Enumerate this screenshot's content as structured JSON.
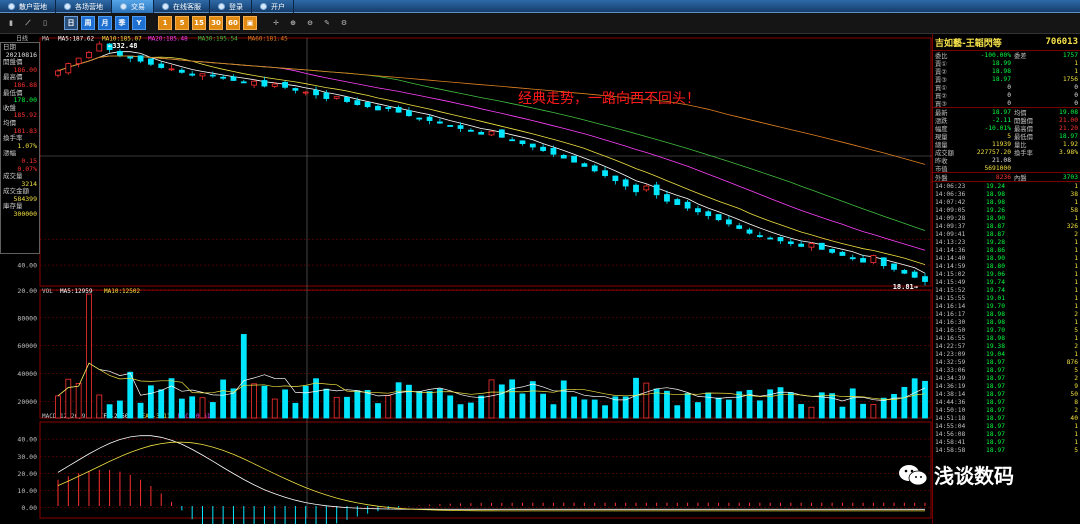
{
  "tabs": [
    "散户营地",
    "各场营地",
    "交易",
    "在线客服",
    "登录",
    "开户"
  ],
  "active_tab": 2,
  "toolbar": {
    "buttons": [
      {
        "icon": "bar-chart-icon",
        "style": "plain",
        "label": "▮"
      },
      {
        "icon": "line-chart-icon",
        "style": "plain",
        "label": "⟋"
      },
      {
        "icon": "candle-icon",
        "style": "plain",
        "label": "▯"
      },
      {
        "icon": "daily-kline-icon",
        "style": "sel",
        "label": "日"
      },
      {
        "icon": "weekly-icon",
        "style": "blue",
        "label": "周"
      },
      {
        "icon": "monthly-icon",
        "style": "blue",
        "label": "月"
      },
      {
        "icon": "quarter-icon",
        "style": "blue",
        "label": "季"
      },
      {
        "icon": "year-icon",
        "style": "blue",
        "label": "Y"
      },
      {
        "icon": "minute-1-icon",
        "style": "orange",
        "label": "1"
      },
      {
        "icon": "minute-5-icon",
        "style": "orange",
        "label": "5"
      },
      {
        "icon": "minute-15-icon",
        "style": "orange",
        "label": "15"
      },
      {
        "icon": "minute-30-icon",
        "style": "orange",
        "label": "30"
      },
      {
        "icon": "minute-60-icon",
        "style": "orange",
        "label": "60"
      },
      {
        "icon": "lock-period-icon",
        "style": "orange",
        "label": "▣"
      },
      {
        "icon": "crosshair-icon",
        "style": "plain",
        "label": "✛"
      },
      {
        "icon": "zoom-in-icon",
        "style": "plain",
        "label": "⊕"
      },
      {
        "icon": "zoom-out-icon",
        "style": "plain",
        "label": "⊖"
      },
      {
        "icon": "draw-tool-icon",
        "style": "plain",
        "label": "✎"
      },
      {
        "icon": "settings-gear-icon",
        "style": "plain",
        "label": "⚙"
      }
    ]
  },
  "chart_header": {
    "period": "日线",
    "ma_label": "MA",
    "ma5": "MA5:187.62",
    "ma10": "MA10:185.07",
    "ma20": "MA20:185.48",
    "ma30": "MA30:195.54",
    "ma60": "MA60:181.45",
    "high_mark": "332.48",
    "low_mark": "18.81"
  },
  "volume_header": {
    "label": "VOL",
    "ma5": "MA5:12959",
    "ma10": "MA10:12502"
  },
  "macd_header": {
    "label": "MACD(12,26,9)",
    "dif": "DIF:-2.50",
    "dea": "DEA:-3.11",
    "macd": "MACD:0.61"
  },
  "info_panel": [
    {
      "label": "日期",
      "value": "20210816",
      "color": "white"
    },
    {
      "label": "開盤價",
      "value": "186.00",
      "color": "red"
    },
    {
      "label": "最高價",
      "value": "186.88",
      "color": "red"
    },
    {
      "label": "最低價",
      "value": "178.00",
      "color": "green"
    },
    {
      "label": "收盤",
      "value": "185.92",
      "color": "red"
    },
    {
      "label": "均價",
      "value": "181.83",
      "color": "red"
    },
    {
      "label": "換手率",
      "value": "1.07%",
      "color": "yellow"
    },
    {
      "label": "漲幅",
      "value": "0.15",
      "color": "red"
    },
    {
      "label": "",
      "value": "0.07%",
      "color": "red"
    },
    {
      "label": "成交量",
      "value": "3214",
      "color": "yellow"
    },
    {
      "label": "成交金額",
      "value": "584399",
      "color": "yellow"
    },
    {
      "label": "庫存量",
      "value": "300000",
      "color": "yellow"
    }
  ],
  "quote": {
    "name": "吉如藝-王韜閃等",
    "code": "706013",
    "top_rows": [
      {
        "c1": "委比",
        "c2": "-100.00%",
        "c2color": "green",
        "c3": "委差",
        "c4": "1757",
        "c4color": "green"
      },
      {
        "c1": "賣①",
        "c2": "18.99",
        "c2color": "green",
        "c3": "",
        "c4": "1",
        "c4color": "yellow"
      },
      {
        "c1": "賣②",
        "c2": "18.98",
        "c2color": "green",
        "c3": "",
        "c4": "1",
        "c4color": "yellow"
      },
      {
        "c1": "賣③",
        "c2": "18.97",
        "c2color": "green",
        "c3": "",
        "c4": "1756",
        "c4color": "yellow"
      },
      {
        "c1": "買①",
        "c2": "0",
        "c2color": "white",
        "c3": "",
        "c4": "0",
        "c4color": "white"
      },
      {
        "c1": "買②",
        "c2": "0",
        "c2color": "white",
        "c3": "",
        "c4": "0",
        "c4color": "white"
      },
      {
        "c1": "買③",
        "c2": "0",
        "c2color": "white",
        "c3": "",
        "c4": "0",
        "c4color": "white"
      }
    ],
    "stat_rows": [
      {
        "c1": "最新",
        "c2": "18.97",
        "c2color": "green",
        "c3": "均價",
        "c4": "19.08",
        "c4color": "green"
      },
      {
        "c1": "漲跌",
        "c2": "-2.11",
        "c2color": "green",
        "c3": "開盤價",
        "c4": "21.00",
        "c4color": "red"
      },
      {
        "c1": "幅度",
        "c2": "-10.01%",
        "c2color": "green",
        "c3": "最高價",
        "c4": "21.20",
        "c4color": "red"
      },
      {
        "c1": "現量",
        "c2": "5",
        "c2color": "yellow",
        "c3": "最低價",
        "c4": "18.97",
        "c4color": "green"
      },
      {
        "c1": "總量",
        "c2": "11939",
        "c2color": "yellow",
        "c3": "量比",
        "c4": "1.92",
        "c4color": "yellow"
      },
      {
        "c1": "成交額",
        "c2": "227757.20",
        "c2color": "yellow",
        "c3": "換手率",
        "c4": "3.98%",
        "c4color": "yellow"
      },
      {
        "c1": "昨收",
        "c2": "21.08",
        "c2color": "white",
        "c3": "",
        "c4": "",
        "c4color": "white"
      },
      {
        "c1": "市值",
        "c2": "5691000",
        "c2color": "yellow",
        "c3": "",
        "c4": "",
        "c4color": "white"
      }
    ],
    "pan_row": {
      "c1": "外盤",
      "c2": "8236",
      "c2color": "red",
      "c3": "內盤",
      "c4": "3703",
      "c4color": "green"
    },
    "ticks": [
      {
        "t": "14:06:23",
        "p": "19.24",
        "v": "1"
      },
      {
        "t": "14:06:36",
        "p": "18.98",
        "v": "38"
      },
      {
        "t": "14:07:42",
        "p": "18.98",
        "v": "1"
      },
      {
        "t": "14:09:05",
        "p": "19.26",
        "v": "58"
      },
      {
        "t": "14:09:28",
        "p": "18.90",
        "v": "1"
      },
      {
        "t": "14:09:37",
        "p": "18.87",
        "v": "326"
      },
      {
        "t": "14:09:41",
        "p": "18.87",
        "v": "2"
      },
      {
        "t": "14:13:23",
        "p": "19.28",
        "v": "1"
      },
      {
        "t": "14:14:36",
        "p": "18.86",
        "v": "1"
      },
      {
        "t": "14:14:40",
        "p": "18.90",
        "v": "1"
      },
      {
        "t": "14:14:59",
        "p": "18.80",
        "v": "1"
      },
      {
        "t": "14:15:02",
        "p": "19.06",
        "v": "1"
      },
      {
        "t": "14:15:49",
        "p": "19.74",
        "v": "1"
      },
      {
        "t": "14:15:52",
        "p": "19.74",
        "v": "1"
      },
      {
        "t": "14:15:55",
        "p": "19.01",
        "v": "1"
      },
      {
        "t": "14:16:14",
        "p": "19.70",
        "v": "1"
      },
      {
        "t": "14:16:17",
        "p": "18.98",
        "v": "2"
      },
      {
        "t": "14:16:30",
        "p": "18.98",
        "v": "1"
      },
      {
        "t": "14:16:50",
        "p": "19.70",
        "v": "5"
      },
      {
        "t": "14:16:55",
        "p": "18.98",
        "v": "1"
      },
      {
        "t": "14:22:57",
        "p": "19.38",
        "v": "2"
      },
      {
        "t": "14:23:09",
        "p": "19.04",
        "v": "1"
      },
      {
        "t": "14:32:59",
        "p": "18.97",
        "v": "876"
      },
      {
        "t": "14:33:06",
        "p": "18.97",
        "v": "5"
      },
      {
        "t": "14:34:39",
        "p": "18.97",
        "v": "2"
      },
      {
        "t": "14:36:19",
        "p": "18.97",
        "v": "9"
      },
      {
        "t": "14:38:14",
        "p": "18.97",
        "v": "50"
      },
      {
        "t": "14:44:36",
        "p": "18.97",
        "v": "8"
      },
      {
        "t": "14:50:10",
        "p": "18.97",
        "v": "2"
      },
      {
        "t": "14:51:18",
        "p": "18.97",
        "v": "40"
      },
      {
        "t": "14:55:04",
        "p": "18.97",
        "v": "1"
      },
      {
        "t": "14:56:08",
        "p": "18.97",
        "v": "1"
      },
      {
        "t": "14:58:41",
        "p": "18.97",
        "v": "1"
      },
      {
        "t": "14:58:58",
        "p": "18.97",
        "v": "5"
      }
    ]
  },
  "annotation": "经典走势，一路向西不回头！",
  "watermark": "浅谈数码",
  "colors": {
    "up": "#ff3030",
    "down": "#00e6ff",
    "ma5": "#ffffff",
    "ma10": "#f0e040",
    "ma20": "#ff40ff",
    "ma30": "#40c040",
    "ma60": "#e08020",
    "grid": "#8a0000"
  },
  "chart_data": [
    {
      "type": "candlestick",
      "title": "日线",
      "ylabels": [
        "60.00",
        "40.00",
        "20.00"
      ],
      "ylim": [
        20,
        340
      ],
      "trend": "decline from 332.48 to 18.81",
      "series": [
        {
          "name": "MA5"
        },
        {
          "name": "MA10"
        },
        {
          "name": "MA20"
        },
        {
          "name": "MA30"
        },
        {
          "name": "MA60"
        }
      ],
      "closes": [
        240,
        262,
        280,
        300,
        332,
        310,
        290,
        280,
        270,
        260,
        250,
        246,
        236,
        228,
        232,
        226,
        220,
        214,
        208,
        212,
        200,
        205,
        197,
        190,
        186,
        180,
        172,
        176,
        166,
        160,
        156,
        150,
        154,
        146,
        140,
        136,
        132,
        128,
        124,
        120,
        116,
        112,
        116,
        108,
        104,
        100,
        96,
        92,
        88,
        84,
        80,
        76,
        72,
        68,
        64,
        60,
        56,
        60,
        54,
        50,
        48,
        46,
        44,
        42,
        40,
        38,
        36,
        34,
        33,
        32,
        31,
        30,
        29,
        30,
        28,
        27,
        26,
        25,
        24,
        26,
        23,
        22,
        21,
        20,
        19
      ]
    },
    {
      "type": "bar",
      "title": "VOL",
      "ylabels": [
        "80000",
        "60000",
        "40000",
        "20000"
      ],
      "ylim": [
        0,
        95000
      ],
      "series": [
        {
          "name": "MA5"
        },
        {
          "name": "MA10"
        }
      ]
    },
    {
      "type": "line",
      "title": "MACD(12,26,9)",
      "ylabels": [
        "40.00",
        "30.00",
        "20.00",
        "10.00",
        "0.00"
      ],
      "ylim": [
        -5,
        50
      ],
      "series": [
        {
          "name": "DIF"
        },
        {
          "name": "DEA"
        },
        {
          "name": "MACD"
        }
      ]
    }
  ]
}
